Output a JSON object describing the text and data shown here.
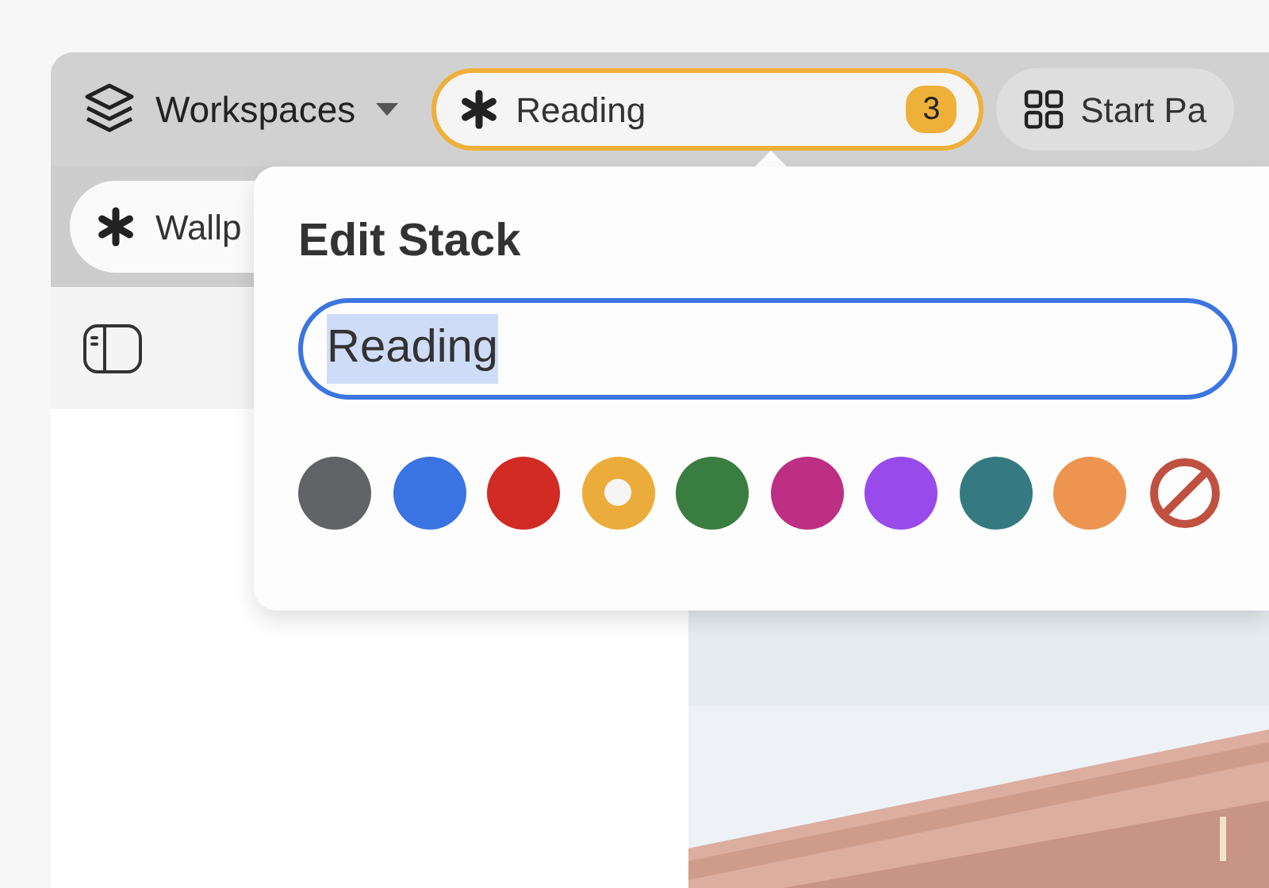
{
  "workspace_switcher": {
    "label": "Workspaces"
  },
  "top_tabs": [
    {
      "label": "Reading",
      "badge": "3",
      "kind": "stack",
      "selected": true
    },
    {
      "label": "Start Pa",
      "kind": "page",
      "selected": false
    }
  ],
  "second_row_tabs": [
    {
      "label": "Wallp"
    }
  ],
  "popover": {
    "title": "Edit Stack",
    "name_field": {
      "value": "Reading"
    },
    "swatches": [
      {
        "kind": "color",
        "color": "#626366",
        "selected": false
      },
      {
        "kind": "color",
        "color": "#3a73e2",
        "selected": false
      },
      {
        "kind": "color",
        "color": "#d12b24",
        "selected": false
      },
      {
        "kind": "color",
        "color": "#ecac3c",
        "selected": true
      },
      {
        "kind": "color",
        "color": "#3a7d40",
        "selected": false
      },
      {
        "kind": "color",
        "color": "#bd2f82",
        "selected": false
      },
      {
        "kind": "color",
        "color": "#984aeb",
        "selected": false
      },
      {
        "kind": "color",
        "color": "#357a80",
        "selected": false
      },
      {
        "kind": "color",
        "color": "#ed9450",
        "selected": false
      },
      {
        "kind": "none",
        "color": "#c0503f",
        "selected": false
      }
    ]
  }
}
